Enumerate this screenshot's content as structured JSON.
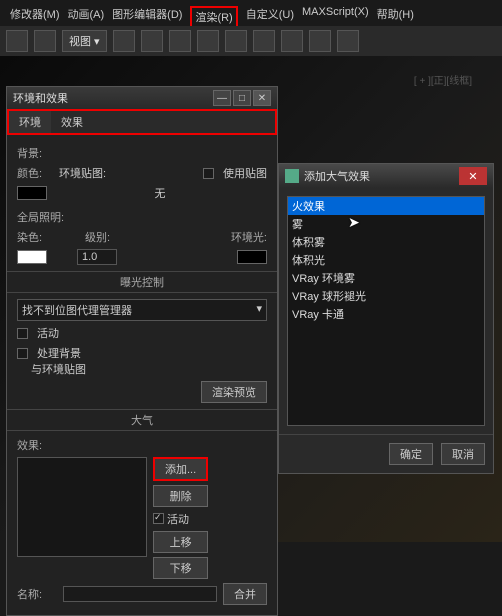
{
  "menubar": {
    "items": [
      "修改器(M)",
      "动画(A)",
      "图形编辑器(D)",
      "渲染(R)",
      "自定义(U)",
      "MAXScript(X)",
      "帮助(H)"
    ]
  },
  "viewDropdown": "视图",
  "bgText": "[ + ][正][线框]",
  "dialog1": {
    "title": "环境和效果",
    "tabs": [
      "环境",
      "效果"
    ],
    "bgSection": {
      "label": "背景:",
      "colorLabel": "颜色:",
      "envMapLabel": "环境贴图:",
      "none": "无",
      "useMap": "使用贴图"
    },
    "globalLight": {
      "label": "全局照明:",
      "tintLabel": "染色:",
      "levelLabel": "级别:",
      "levelValue": "1.0",
      "envLightLabel": "环境光:"
    },
    "exposureTitle": "曝光控制",
    "exposureDropdown": "找不到位图代理管理器",
    "activeLabel": "活动",
    "processBg": "处理背景",
    "envMapLabel2": "与环境贴图",
    "renderPreview": "渲染预览",
    "atmosTitle": "大气",
    "effectsLabel": "效果:",
    "addBtn": "添加...",
    "deleteBtn": "删除",
    "activeChk": "活动",
    "moveUp": "上移",
    "moveDown": "下移",
    "nameLabel": "名称:",
    "mergeBtn": "合并"
  },
  "dialog2": {
    "title": "添加大气效果",
    "items": [
      "火效果",
      "雾",
      "体积雾",
      "体积光",
      "VRay 环境雾",
      "VRay 球形褪光",
      "VRay 卡通"
    ],
    "ok": "确定",
    "cancel": "取消"
  }
}
